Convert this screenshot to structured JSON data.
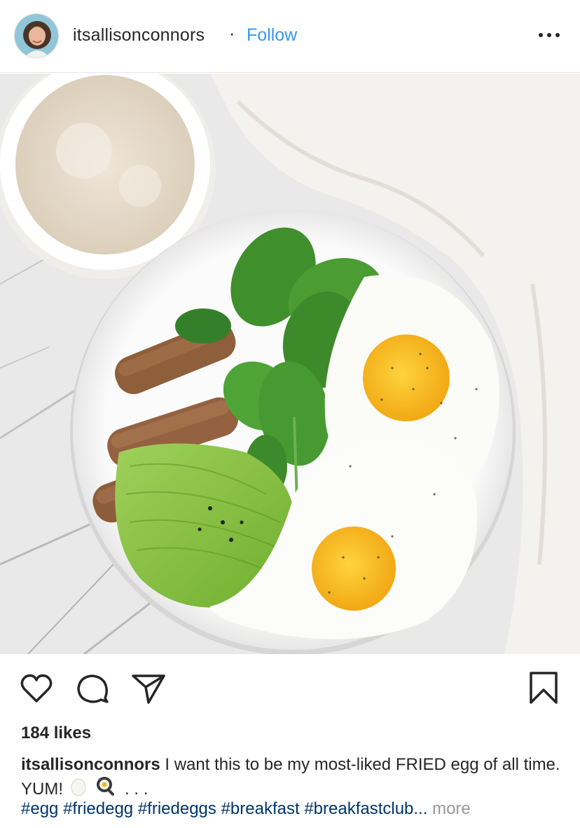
{
  "post": {
    "username": "itsallisonconnors",
    "separator": "·",
    "follow_label": "Follow",
    "more_icon": "more-horizontal-icon"
  },
  "actions": {
    "like_icon": "heart-icon",
    "comment_icon": "comment-icon",
    "share_icon": "paper-plane-icon",
    "save_icon": "bookmark-icon"
  },
  "likes_text": "184 likes",
  "caption": {
    "username": "itsallisonconnors",
    "text": "I want this to be my most-liked FRIED egg of all time. YUM!",
    "emojis": [
      "egg-emoji",
      "cooking-emoji"
    ],
    "trailing": ". . ."
  },
  "hashtags": [
    "#egg",
    "#friedegg",
    "#friedeggs",
    "#breakfast",
    "#breakfastclub..."
  ],
  "more_label": "more",
  "colors": {
    "follow": "#3897f0",
    "hashtag": "#003569",
    "muted": "#999999"
  }
}
